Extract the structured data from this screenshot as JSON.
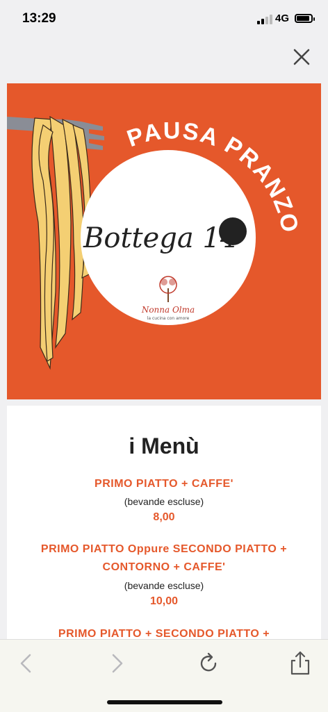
{
  "status_bar": {
    "time": "13:29",
    "network": "4G"
  },
  "banner": {
    "headline": "PAUSA PRANZO",
    "brand": "Bottega 14",
    "sub_brand": "Nonna Olma",
    "sub_tagline": "la cucina con amore"
  },
  "menu": {
    "title": "i Menù",
    "items": [
      {
        "name": "PRIMO PIATTO + CAFFE'",
        "note": "(bevande escluse)",
        "price": "8,00"
      },
      {
        "name_line1": "PRIMO PIATTO Oppure SECONDO PIATTO +",
        "name_line2": "CONTORNO + CAFFE'",
        "note": "(bevande escluse)",
        "price": "10,00"
      },
      {
        "name": "PRIMO PIATTO + SECONDO PIATTO +"
      }
    ]
  },
  "toolbar": {
    "back": "back-icon",
    "forward": "forward-icon",
    "reload": "reload-icon",
    "share": "share-icon"
  },
  "colors": {
    "accent": "#e5582b",
    "background": "#f0f0f2"
  }
}
